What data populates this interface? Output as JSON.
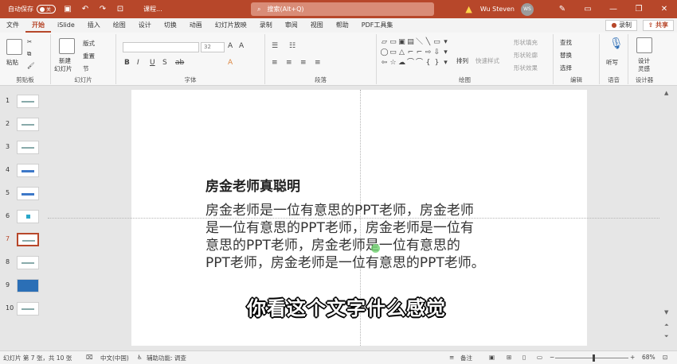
{
  "titlebar": {
    "autosave_label": "自动保存",
    "autosave_state": "关",
    "file_name": "课程...",
    "search_placeholder": "搜索(Alt+Q)",
    "user_name": "Wu Steven",
    "user_initials": "WS"
  },
  "tabs": [
    "文件",
    "开始",
    "iSlide",
    "插入",
    "绘图",
    "设计",
    "切换",
    "动画",
    "幻灯片放映",
    "录制",
    "审阅",
    "视图",
    "帮助",
    "PDF工具集"
  ],
  "active_tab": "开始",
  "record_label": "录制",
  "share_label": "共享",
  "ribbon": {
    "clipboard": {
      "label": "剪贴板",
      "paste": "粘贴"
    },
    "slides": {
      "label": "幻灯片",
      "new_slide": "新建",
      "new_slide2": "幻灯片",
      "layout": "版式",
      "reset": "重置",
      "section": "节"
    },
    "font": {
      "label": "字体",
      "size": "32"
    },
    "paragraph": {
      "label": "段落"
    },
    "drawing": {
      "label": "绘图",
      "arrange": "排列",
      "quick_styles": "快速样式",
      "fill": "形状填充",
      "outline": "形状轮廓",
      "effects": "形状效果"
    },
    "editing": {
      "label": "编辑",
      "find": "查找",
      "replace": "替换",
      "select": "选择"
    },
    "voice": {
      "label": "语音",
      "dictate": "听写"
    },
    "designer": {
      "label": "设计器",
      "design_ideas": "设计",
      "design_ideas2": "灵感"
    }
  },
  "thumbnails": [
    {
      "num": "1"
    },
    {
      "num": "2"
    },
    {
      "num": "3"
    },
    {
      "num": "4"
    },
    {
      "num": "5"
    },
    {
      "num": "6"
    },
    {
      "num": "7"
    },
    {
      "num": "8"
    },
    {
      "num": "9"
    },
    {
      "num": "10"
    }
  ],
  "active_slide": "7",
  "slide": {
    "title": "房金老师真聪明",
    "body_lines": [
      "房金老师是一位有意思的PPT老师，房金老师",
      "是一位有意思的PPT老师，房金老师是一位有",
      "意思的PPT老师，房金老师是一位有意思的",
      "PPT老师，房金老师是一位有意思的PPT老师。"
    ]
  },
  "subtitle_caption": "你看这个文字什么感觉",
  "statusbar": {
    "slide_info": "幻灯片 第 7 张，共 10 张",
    "language": "中文(中国)",
    "accessibility": "辅助功能: 调查",
    "notes": "备注",
    "zoom": "68%"
  },
  "colors": {
    "accent": "#b7472a"
  }
}
